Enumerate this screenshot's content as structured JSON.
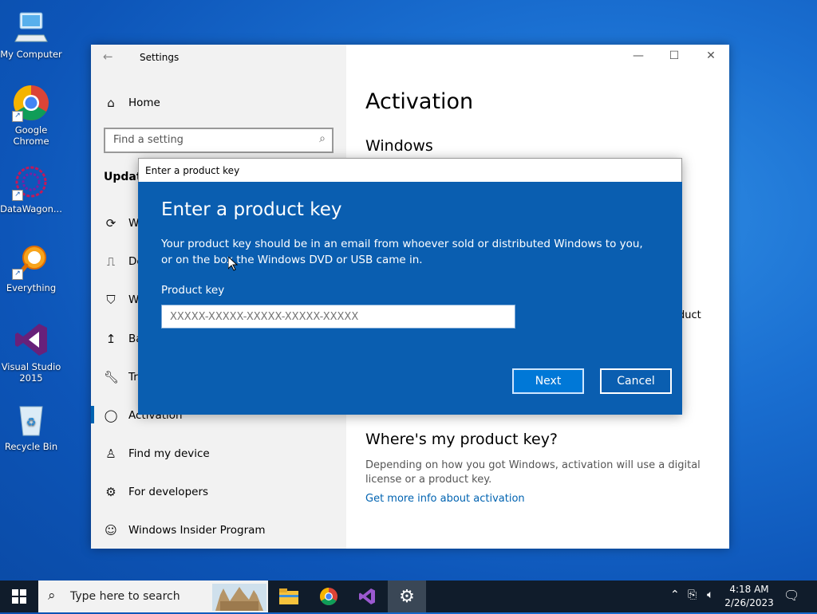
{
  "desktop": {
    "icons": [
      {
        "label": "My Computer"
      },
      {
        "label": "Google Chrome"
      },
      {
        "label": "DataWagon..."
      },
      {
        "label": "Everything"
      },
      {
        "label": "Visual Studio 2015"
      },
      {
        "label": "Recycle Bin"
      }
    ]
  },
  "window": {
    "title": "Settings",
    "controls": {
      "minimize": "—",
      "maximize": "☐",
      "close": "✕"
    }
  },
  "sidebar": {
    "home_label": "Home",
    "search_placeholder": "Find a setting",
    "section_title_partial": "Update",
    "items": [
      {
        "label": "W"
      },
      {
        "label": "De"
      },
      {
        "label": "W"
      },
      {
        "label": "Ba"
      },
      {
        "label": "Tr"
      },
      {
        "label": "Activation"
      },
      {
        "label": "Find my device"
      },
      {
        "label": "For developers"
      },
      {
        "label": "Windows Insider Program"
      }
    ]
  },
  "main": {
    "page_title": "Activation",
    "section_windows": "Windows",
    "partial_text_right": "duct",
    "help_heading": "Where's my product key?",
    "help_text": "Depending on how you got Windows, activation will use a digital license or a product key.",
    "help_link": "Get more info about activation"
  },
  "dialog": {
    "window_title": "Enter a product key",
    "heading": "Enter a product key",
    "description": "Your product key should be in an email from whoever sold or distributed Windows to you, or on the box the Windows DVD or USB came in.",
    "field_label": "Product key",
    "field_placeholder": "XXXXX-XXXXX-XXXXX-XXXXX-XXXXX",
    "next_label": "Next",
    "cancel_label": "Cancel"
  },
  "taskbar": {
    "search_placeholder": "Type here to search",
    "time": "4:18 AM",
    "date": "2/26/2023"
  },
  "colors": {
    "dialog_blue": "#0a5eb0",
    "accent": "#0078d7",
    "link": "#0063b1"
  }
}
